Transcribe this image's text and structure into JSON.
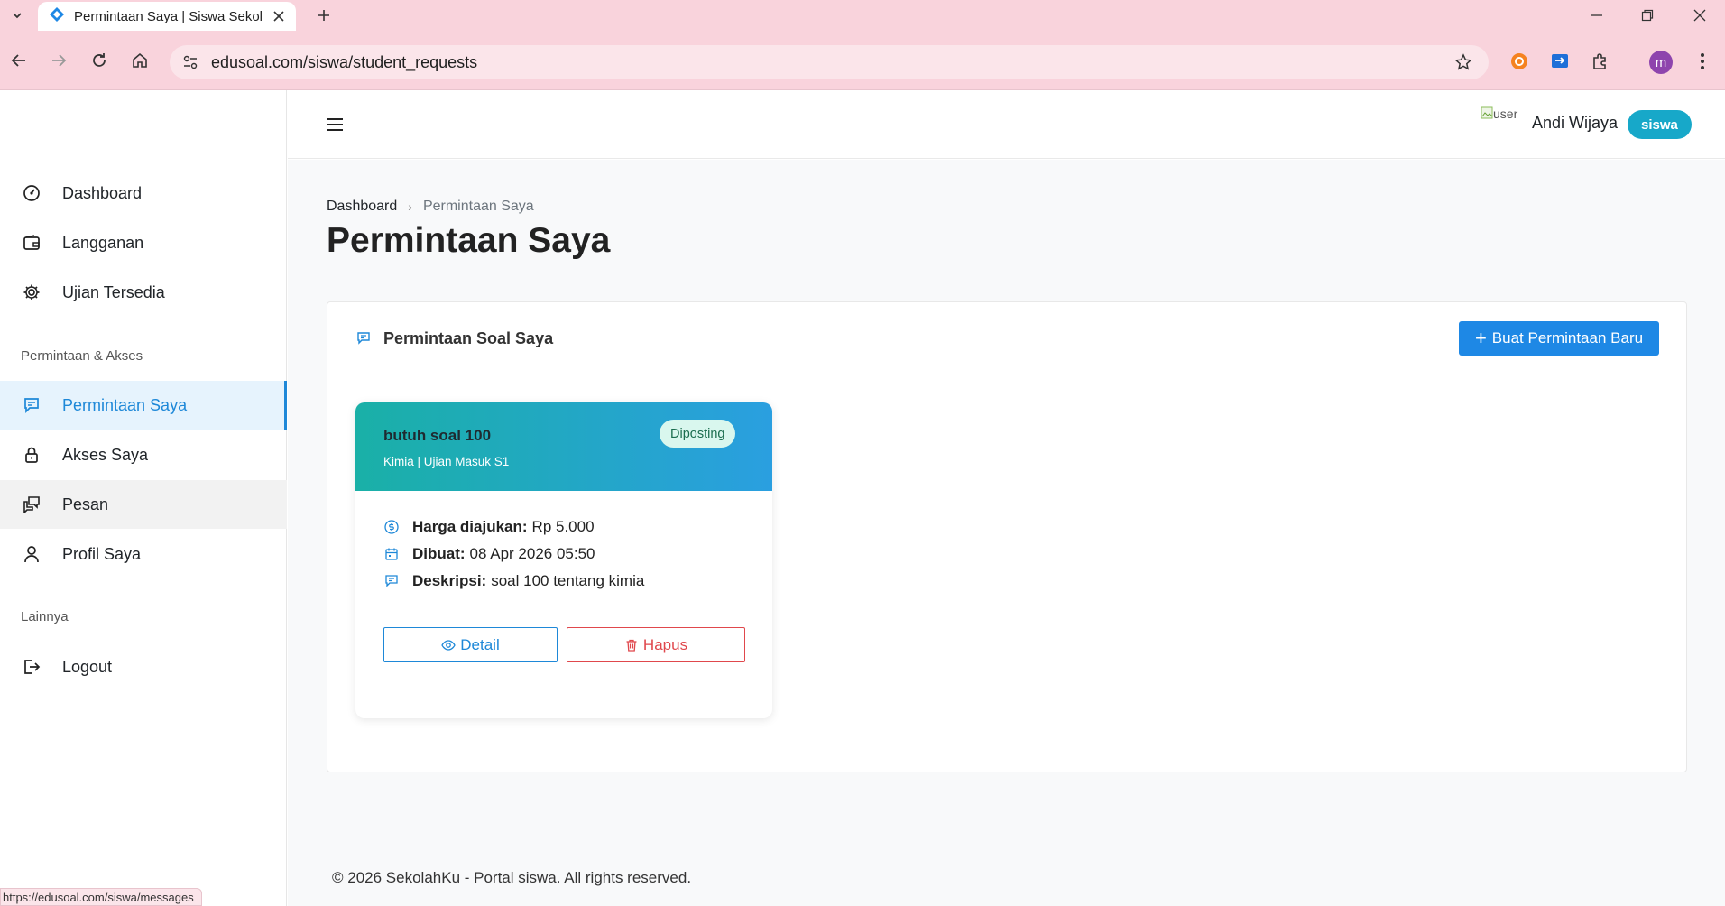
{
  "browser": {
    "tab_title": "Permintaan Saya | Siswa Sekolah",
    "url": "edusoal.com/siswa/student_requests",
    "profile_initial": "m",
    "status_url": "https://edusoal.com/siswa/messages"
  },
  "sidebar": {
    "items": [
      {
        "label": "Dashboard",
        "icon": "gauge-icon"
      },
      {
        "label": "Langganan",
        "icon": "wallet-icon"
      },
      {
        "label": "Ujian Tersedia",
        "icon": "gear-icon"
      }
    ],
    "section_requests": "Permintaan & Akses",
    "request_items": [
      {
        "label": "Permintaan Saya",
        "icon": "chat-icon",
        "active": true
      },
      {
        "label": "Akses Saya",
        "icon": "lock-icon"
      },
      {
        "label": "Pesan",
        "icon": "messages-icon"
      },
      {
        "label": "Profil Saya",
        "icon": "user-icon"
      }
    ],
    "section_other": "Lainnya",
    "logout": "Logout"
  },
  "header": {
    "avatar_alt": "user",
    "user_name": "Andi Wijaya",
    "role": "siswa"
  },
  "breadcrumb": {
    "home": "Dashboard",
    "separator": "›",
    "current": "Permintaan Saya"
  },
  "page_title": "Permintaan Saya",
  "card": {
    "title": "Permintaan Soal Saya",
    "new_button": "Buat Permintaan Baru",
    "new_button_plus": "+"
  },
  "request": {
    "title": "butuh soal 100",
    "subtitle": "Kimia | Ujian Masuk S1",
    "status": "Diposting",
    "price_label": "Harga diajukan:",
    "price_value": "Rp 5.000",
    "created_label": "Dibuat:",
    "created_value": "08 Apr 2026 05:50",
    "desc_label": "Deskripsi:",
    "desc_value": "soal 100 tentang kimia",
    "detail_button": "Detail",
    "delete_button": "Hapus"
  },
  "footer": "© 2026 SekolahKu - Portal siswa. All rights reserved.",
  "colors": {
    "accent": "#1e88e5",
    "danger": "#e0474c",
    "badge": "#17a8c9",
    "chrome": "#f9d3dc"
  }
}
